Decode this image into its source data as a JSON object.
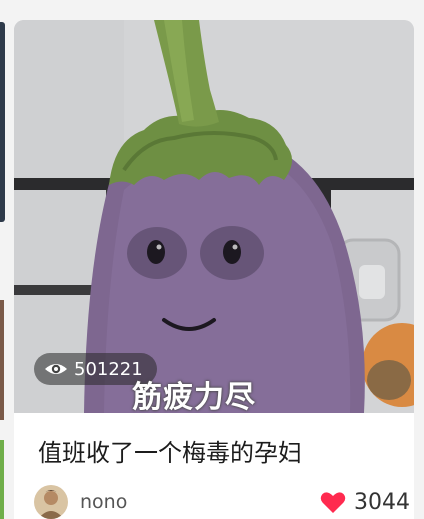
{
  "card": {
    "image": {
      "view_count": "501221",
      "overlay_caption": "筋疲力尽",
      "views_icon": "eye-icon"
    },
    "title": "值班收了一个梅毒的孕妇",
    "author": {
      "name": "nono",
      "avatar_icon": "avatar"
    },
    "likes": {
      "count": "3044",
      "icon": "heart-icon",
      "color": "#ff2a4f"
    }
  }
}
